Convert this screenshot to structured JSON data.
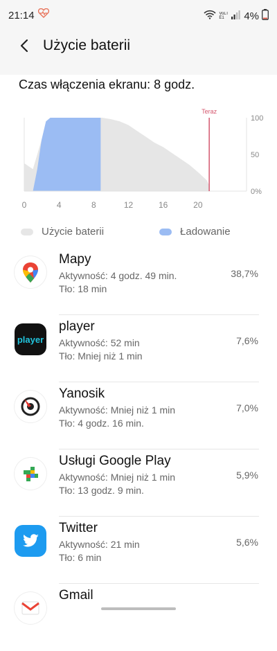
{
  "status_bar": {
    "time": "21:14",
    "network_label": "VoLTE1",
    "battery_percent": "4%"
  },
  "header": {
    "title": "Użycie baterii"
  },
  "screen_on_time": "Czas włączenia ekranu: 8 godz.",
  "chart_data": {
    "type": "area",
    "x_ticks": [
      "0",
      "4",
      "8",
      "12",
      "16",
      "20"
    ],
    "y_ticks": [
      "100",
      "50",
      "0%"
    ],
    "xlim": [
      0,
      24
    ],
    "ylim": [
      0,
      100
    ],
    "now_label": "Teraz",
    "now_x": 21.3,
    "series": [
      {
        "name": "Użycie baterii",
        "color": "#e6e6e6",
        "x": [
          0,
          1,
          2,
          3,
          4,
          5,
          6,
          7,
          8,
          9,
          10,
          11,
          12,
          13,
          14,
          15,
          16,
          17,
          18,
          19,
          20,
          21,
          21.3
        ],
        "values": [
          38,
          30,
          70,
          100,
          100,
          100,
          100,
          100,
          100,
          100,
          98,
          95,
          90,
          82,
          74,
          66,
          60,
          52,
          44,
          36,
          26,
          15,
          8
        ]
      },
      {
        "name": "Ładowanie",
        "color": "#9bbcf3",
        "x": [
          1,
          1.5,
          2,
          2.5,
          3,
          4,
          5,
          6,
          7,
          8,
          8.8
        ],
        "values": [
          0,
          30,
          70,
          95,
          100,
          100,
          100,
          100,
          100,
          100,
          100
        ]
      }
    ]
  },
  "legend": {
    "usage_label": "Użycie baterii",
    "usage_color": "#e6e6e6",
    "charging_label": "Ładowanie",
    "charging_color": "#9bbcf3"
  },
  "apps": [
    {
      "name": "Mapy",
      "line1": "Aktywność: 4 godz. 49 min.",
      "line2": "Tło: 18 min",
      "percent": "38,7%",
      "icon": "google-maps-icon"
    },
    {
      "name": "player",
      "line1": "Aktywność: 52 min",
      "line2": "Tło: Mniej niż 1 min",
      "percent": "7,6%",
      "icon": "player-icon",
      "icon_text": "player"
    },
    {
      "name": "Yanosik",
      "line1": "Aktywność: Mniej niż 1 min",
      "line2": "Tło: 4 godz. 16 min.",
      "percent": "7,0%",
      "icon": "yanosik-icon"
    },
    {
      "name": "Usługi Google Play",
      "line1": "Aktywność: Mniej niż 1 min",
      "line2": "Tło: 13 godz. 9 min.",
      "percent": "5,9%",
      "icon": "google-play-services-icon"
    },
    {
      "name": "Twitter",
      "line1": "Aktywność: 21 min",
      "line2": "Tło: 6 min",
      "percent": "5,6%",
      "icon": "twitter-icon"
    },
    {
      "name": "Gmail",
      "line1": "",
      "line2": "",
      "percent": "",
      "icon": "gmail-icon"
    }
  ]
}
